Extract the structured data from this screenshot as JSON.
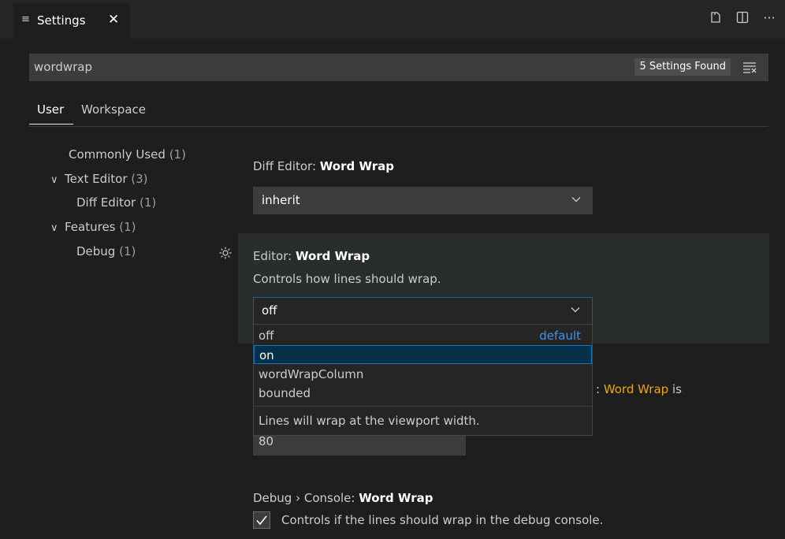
{
  "tab": {
    "title": "Settings",
    "icon": "settings-list-icon",
    "close": "✕"
  },
  "actions": {
    "more": "···"
  },
  "search": {
    "value": "wordwrap",
    "results_badge": "5 Settings Found"
  },
  "scopes": {
    "user": "User",
    "workspace": "Workspace"
  },
  "toc": {
    "commonly_used": {
      "label": "Commonly Used",
      "count": "(1)"
    },
    "text_editor": {
      "label": "Text Editor",
      "count": "(3)"
    },
    "diff_editor": {
      "label": "Diff Editor",
      "count": "(1)"
    },
    "features": {
      "label": "Features",
      "count": "(1)"
    },
    "debug": {
      "label": "Debug",
      "count": "(1)"
    }
  },
  "settings": {
    "diff_word_wrap": {
      "category": "Diff Editor: ",
      "name": "Word Wrap",
      "value": "inherit"
    },
    "editor_word_wrap": {
      "category": "Editor: ",
      "name": "Word Wrap",
      "description": "Controls how lines should wrap.",
      "value": "off",
      "options": [
        "off",
        "on",
        "wordWrapColumn",
        "bounded"
      ],
      "default_label": "default",
      "option_description": "Lines will wrap at the viewport width."
    },
    "column_partial": {
      "prefix": ": ",
      "link": "Word Wrap",
      "suffix": " is"
    },
    "column_value": "80",
    "debug_word_wrap": {
      "category": "Debug › Console: ",
      "name": "Word Wrap",
      "description": "Controls if the lines should wrap in the debug console.",
      "checked": true
    }
  },
  "colors": {
    "accent": "#0e639c",
    "link": "#f0a500",
    "default_label": "#3794ff"
  }
}
